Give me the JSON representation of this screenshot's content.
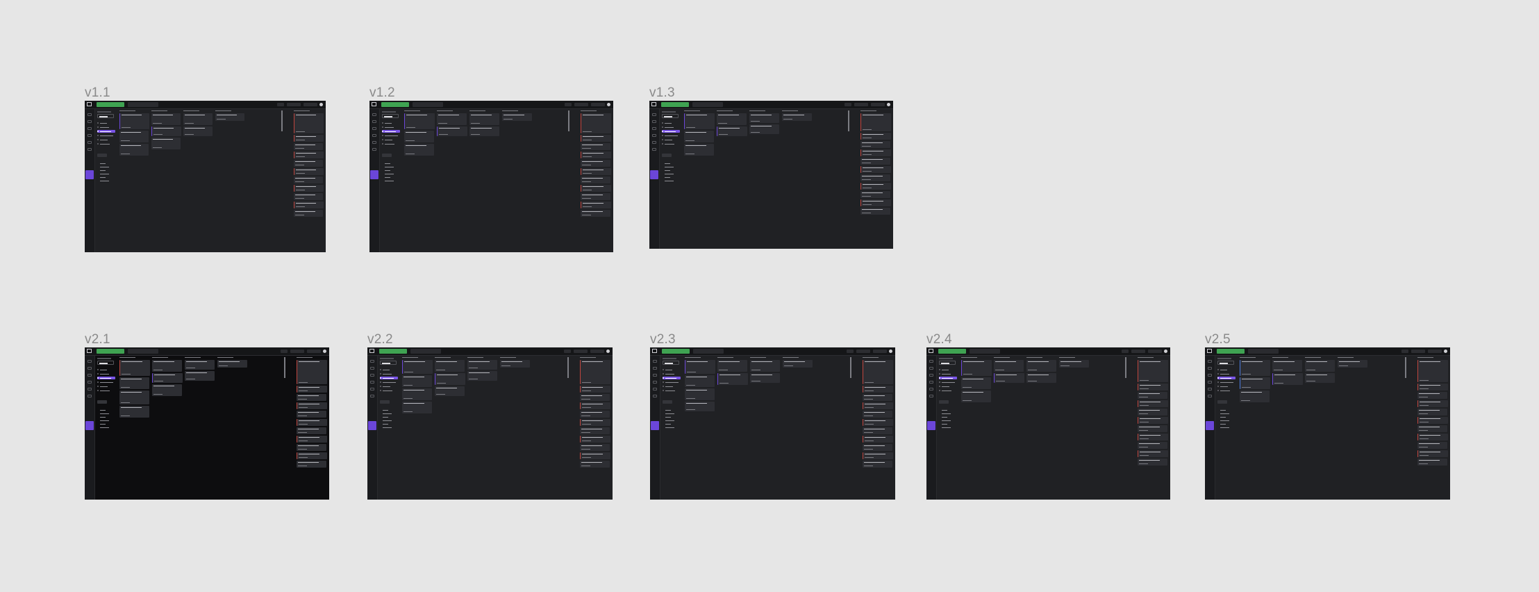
{
  "canvas": {
    "background": "#e6e6e6",
    "label_color": "#8a8a8a"
  },
  "theme": {
    "app_background": "#202124",
    "app_background_black": "#0d0d0f",
    "create_button": "#3fa352",
    "accent": "#6b46d9",
    "card": "#2d2e33",
    "card_red_stripe": "#c0453e",
    "card_purple_stripe": "#6b46d9"
  },
  "frames": [
    {
      "label": "v1.1",
      "variant": "standard"
    },
    {
      "label": "v1.2",
      "variant": "standard"
    },
    {
      "label": "v1.3",
      "variant": "standard"
    },
    {
      "label": "v2.1",
      "variant": "black"
    },
    {
      "label": "v2.2",
      "variant": "standard"
    },
    {
      "label": "v2.3",
      "variant": "standard"
    },
    {
      "label": "v2.4",
      "variant": "standard"
    },
    {
      "label": "v2.5",
      "variant": "standard"
    }
  ],
  "icons": {
    "app_logo": "app-logo-icon",
    "settings": "settings-icon"
  }
}
